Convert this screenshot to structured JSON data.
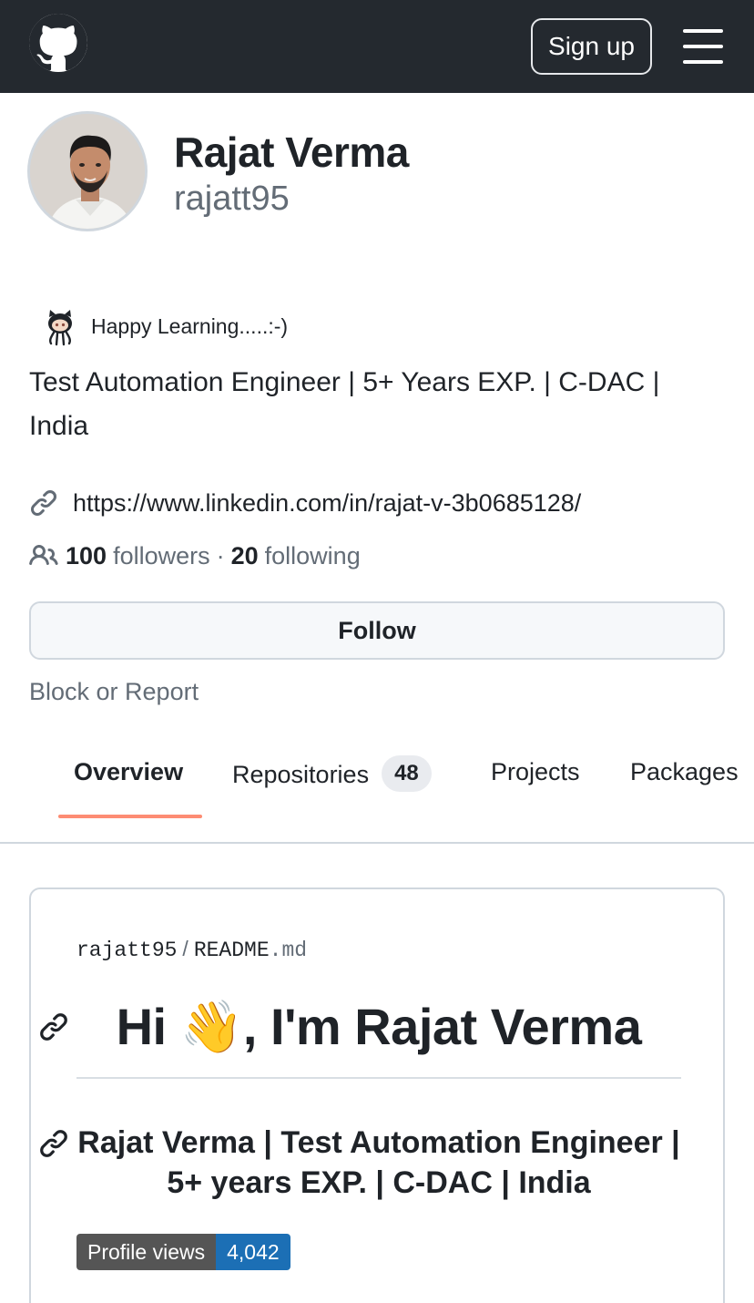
{
  "header": {
    "logo_icon": "github-octocat-icon",
    "signup_label": "Sign up",
    "menu_icon": "hamburger-menu-icon"
  },
  "profile": {
    "name": "Rajat Verma",
    "login": "rajatt95",
    "status_icon": "octocat-emoji-icon",
    "status_text": "Happy Learning.....:-)",
    "bio": "Test Automation Engineer | 5+ Years EXP. | C-DAC | India",
    "link_icon": "link-icon",
    "website": "https://www.linkedin.com/in/rajat-v-3b0685128/",
    "people_icon": "people-icon",
    "followers_count": "100",
    "followers_label": "followers",
    "separator": "·",
    "following_count": "20",
    "following_label": "following",
    "follow_label": "Follow",
    "block_label": "Block or Report"
  },
  "tabs": [
    {
      "label": "Overview",
      "active": true
    },
    {
      "label": "Repositories",
      "count": "48"
    },
    {
      "label": "Projects"
    },
    {
      "label": "Packages"
    }
  ],
  "readme": {
    "owner": "rajatt95",
    "path_separator": "/",
    "file_name": "README",
    "file_ext": ".md",
    "heading": "Hi 👋, I'm Rajat Verma",
    "subheading": "Rajat Verma | Test Automation Engineer | 5+ years EXP. | C-DAC | India",
    "badge_label": "Profile views",
    "badge_value": "4,042"
  },
  "colors": {
    "header_bg": "#24292f",
    "tab_underline": "#fd8c73",
    "badge_label_bg": "#555555",
    "badge_value_bg": "#1c6fb5"
  }
}
